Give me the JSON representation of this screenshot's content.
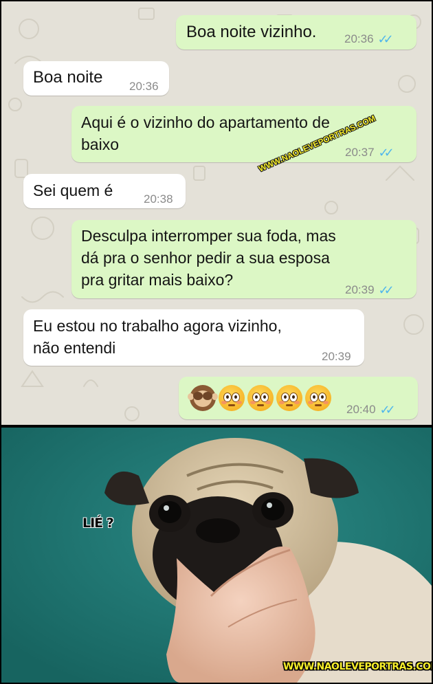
{
  "chat": {
    "messages": [
      {
        "direction": "outgoing",
        "text": "Boa noite vizinho.",
        "time": "20:36",
        "status": "read"
      },
      {
        "direction": "incoming",
        "text": "Boa noite",
        "time": "20:36"
      },
      {
        "direction": "outgoing",
        "text": "Aqui é o vizinho do apartamento de\nbaixo",
        "time": "20:37",
        "status": "read"
      },
      {
        "direction": "incoming",
        "text": "Sei quem é",
        "time": "20:38"
      },
      {
        "direction": "outgoing",
        "text": "Desculpa interromper sua foda, mas\ndá pra o senhor pedir a sua esposa\npra gritar mais baixo?",
        "time": "20:39",
        "status": "read"
      },
      {
        "direction": "incoming",
        "text": "Eu estou no trabalho agora vizinho,\nnão entendi",
        "time": "20:39"
      },
      {
        "direction": "outgoing",
        "emojis": [
          "see-no-evil-monkey",
          "flushed-face",
          "flushed-face",
          "flushed-face",
          "flushed-face"
        ],
        "time": "20:40",
        "status": "read"
      }
    ],
    "ticks_glyph": "✓✓",
    "watermark": "WWW.NAOLEVEPORTRAS.COM",
    "colors": {
      "outgoing_bubble": "#dcf7c5",
      "incoming_bubble": "#ffffff",
      "read_ticks": "#4fb6ec",
      "wallpaper": "#e4e1d8"
    }
  },
  "meme": {
    "caption": "LIÉ ?",
    "site": "WWW.NAOLEVEPORTRAS.COM",
    "colors": {
      "background": "#1f7b77",
      "site_text": "#f7ee2a"
    }
  }
}
